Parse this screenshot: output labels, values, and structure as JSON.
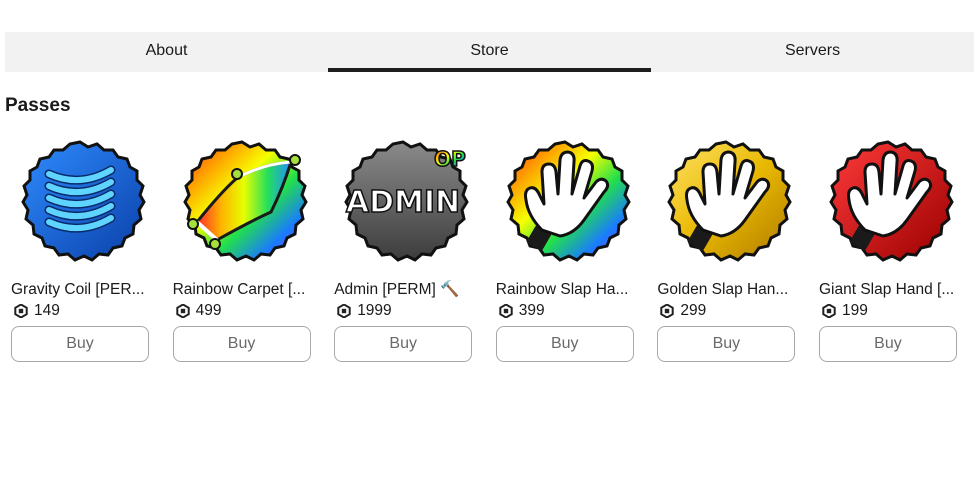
{
  "tabs": [
    {
      "label": "About",
      "active": false
    },
    {
      "label": "Store",
      "active": true
    },
    {
      "label": "Servers",
      "active": false
    }
  ],
  "section_title": "Passes",
  "passes": [
    {
      "name": "Gravity Coil [PER...",
      "price": "149",
      "buy_label": "Buy",
      "icon": "gravity-coil-icon",
      "color": "#1565d8"
    },
    {
      "name": "Rainbow Carpet [...",
      "price": "499",
      "buy_label": "Buy",
      "icon": "rainbow-carpet-icon",
      "color": "rainbow"
    },
    {
      "name": "Admin [PERM] 🔨",
      "price": "1999",
      "buy_label": "Buy",
      "icon": "admin-badge-icon",
      "color": "#6b6b6b",
      "badge_text": "ADMIN",
      "badge_corner_text": "OP"
    },
    {
      "name": "Rainbow Slap Ha...",
      "price": "399",
      "buy_label": "Buy",
      "icon": "rainbow-glove-icon",
      "color": "rainbow"
    },
    {
      "name": "Golden Slap Han...",
      "price": "299",
      "buy_label": "Buy",
      "icon": "golden-glove-icon",
      "color": "#f0c419"
    },
    {
      "name": "Giant Slap Hand [...",
      "price": "199",
      "buy_label": "Buy",
      "icon": "red-glove-icon",
      "color": "#d01818"
    }
  ]
}
